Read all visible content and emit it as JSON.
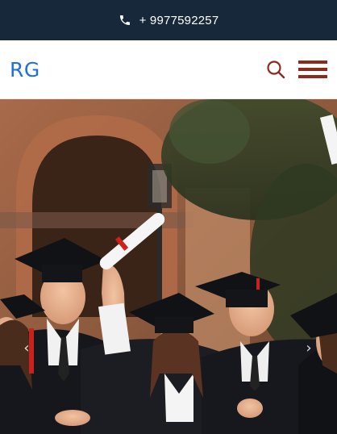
{
  "topbar": {
    "phone_icon": "phone-icon",
    "phone_number": "+ 9977592257"
  },
  "header": {
    "logo": "RG",
    "search_icon": "search-icon",
    "menu_icon": "hamburger-menu-icon"
  },
  "hero": {
    "image": "graduates-celebrating-photo",
    "prev_icon": "chevron-left-icon",
    "next_icon": "chevron-right-icon",
    "prev_glyph": "‹",
    "next_glyph": "›"
  },
  "colors": {
    "topbar_bg": "#16283a",
    "logo": "#1d6fde",
    "accent": "#8b2a1d"
  }
}
